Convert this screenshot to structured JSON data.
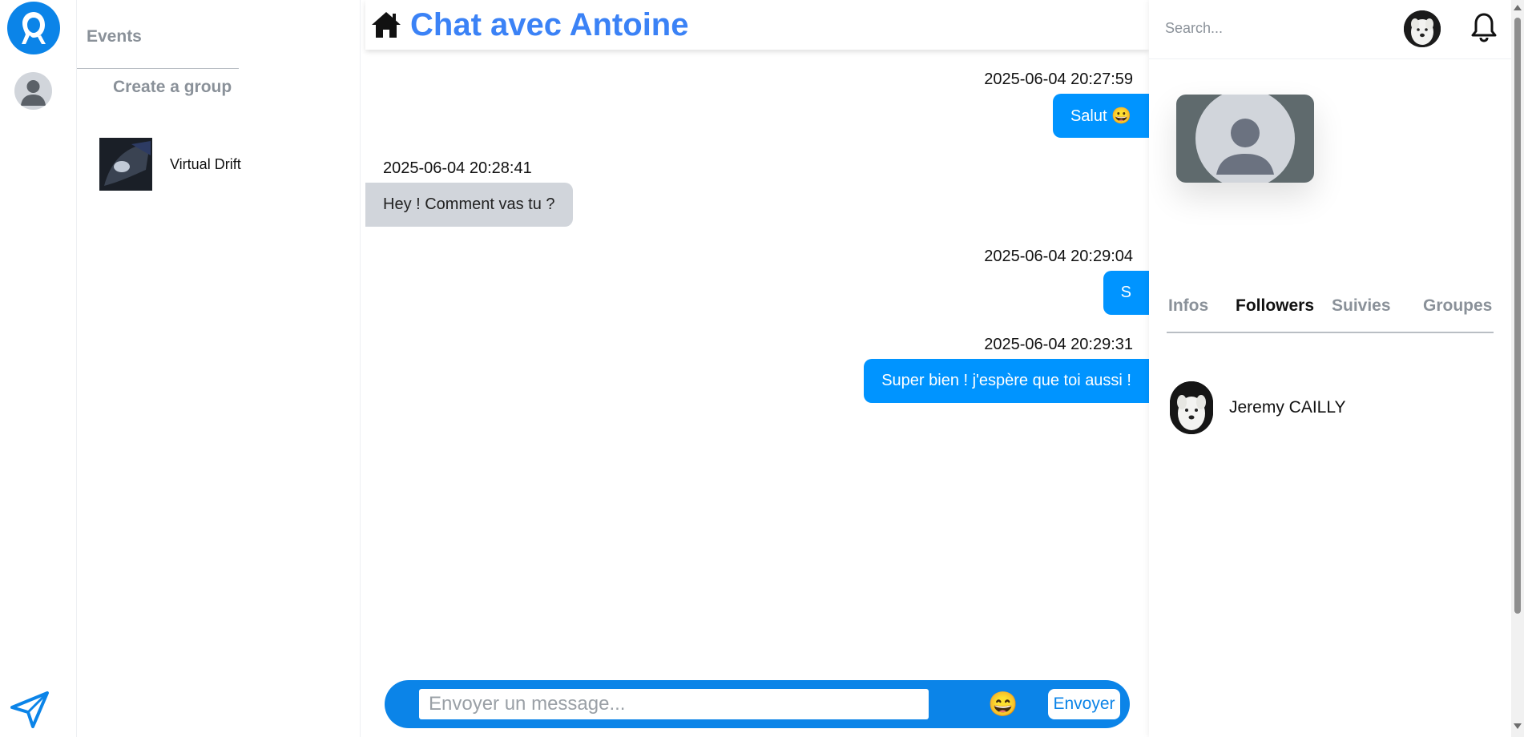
{
  "rail": {
    "logo_icon": "app-logo-icon",
    "avatar_icon": "user-avatar-icon",
    "send_icon": "paper-plane-icon",
    "accent": "#0b84e8"
  },
  "groups": {
    "events_title": "Events",
    "create_group_label": "Create a group",
    "items": [
      {
        "name": "Virtual Drift"
      }
    ]
  },
  "chat": {
    "title": "Chat avec Antoine",
    "home_icon": "home-icon",
    "messages": [
      {
        "timestamp": "2025-06-04 20:27:59",
        "text": "Salut 😀",
        "direction": "sent"
      },
      {
        "timestamp": "2025-06-04 20:28:41",
        "text": "Hey ! Comment vas tu ?",
        "direction": "received"
      },
      {
        "timestamp": "2025-06-04 20:29:04",
        "text": "S",
        "direction": "sent"
      },
      {
        "timestamp": "2025-06-04 20:29:31",
        "text": "Super bien ! j'espère que toi aussi !",
        "direction": "sent"
      }
    ],
    "composer": {
      "placeholder": "Envoyer un message...",
      "value": "",
      "emoji": "😄",
      "send_label": "Envoyer"
    },
    "colors": {
      "sent_bubble": "#0094ff",
      "received_bubble": "#d1d5db",
      "title": "#3b82f6"
    }
  },
  "right": {
    "search_placeholder": "Search...",
    "bell_icon": "bell-icon",
    "tabs": [
      {
        "label": "Infos",
        "active": false
      },
      {
        "label": "Followers",
        "active": true
      },
      {
        "label": "Suivies",
        "active": false
      },
      {
        "label": "Groupes",
        "active": false
      }
    ],
    "followers": [
      {
        "name": "Jeremy CAILLY"
      }
    ]
  }
}
